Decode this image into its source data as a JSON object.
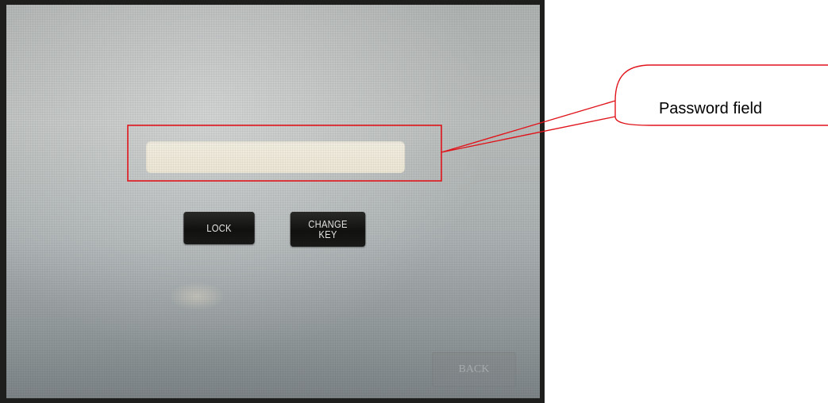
{
  "device_screen": {
    "password_field": {
      "value": "",
      "placeholder": ""
    },
    "buttons": {
      "lock_label": "LOCK",
      "change_key_label": "CHANGE\nKEY",
      "back_label": "BACK"
    }
  },
  "annotation": {
    "callout_text": "Password field",
    "highlight_color": "#e0141b"
  }
}
